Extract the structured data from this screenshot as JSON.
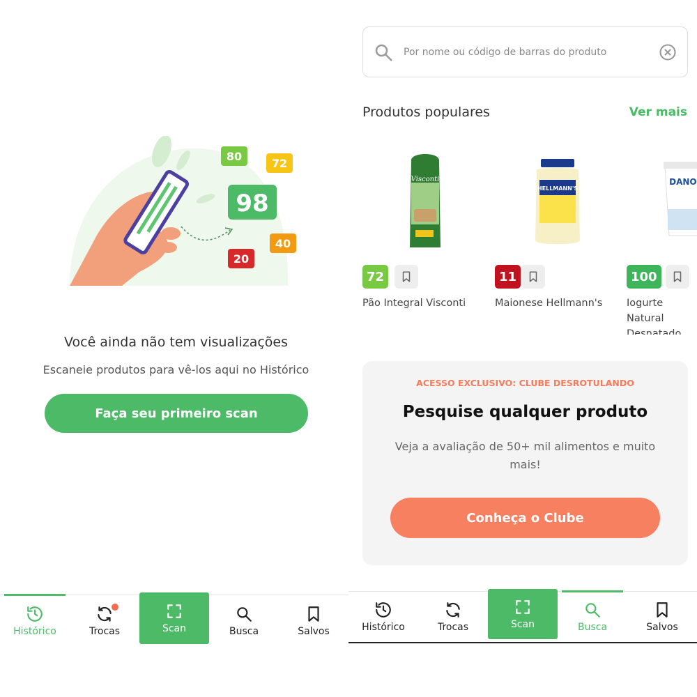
{
  "left_screen": {
    "illustration": {
      "scores": [
        "80",
        "72",
        "98",
        "40",
        "20"
      ]
    },
    "empty_title": "Você ainda não tem visualizações",
    "empty_subtitle": "Escaneie produtos para vê-los aqui no Histórico",
    "primary_button": "Faça seu primeiro scan",
    "tabs": [
      {
        "label": "Histórico",
        "icon": "history-icon",
        "active": true
      },
      {
        "label": "Trocas",
        "icon": "swap-icon",
        "notification": true
      },
      {
        "label": "Scan",
        "icon": "scan-icon"
      },
      {
        "label": "Busca",
        "icon": "search-icon"
      },
      {
        "label": "Salvos",
        "icon": "bookmark-icon"
      }
    ]
  },
  "right_screen": {
    "search": {
      "placeholder": "Por nome ou código de barras do produto"
    },
    "section_title": "Produtos populares",
    "see_more": "Ver mais",
    "products": [
      {
        "name": "Pão Integral Visconti",
        "score": "72",
        "score_color": "#7ac943",
        "brand_mark": "Visconti"
      },
      {
        "name": "Maionese Hellmann's",
        "score": "11",
        "score_color": "#c1121f",
        "brand_mark": "HELLMANN'S"
      },
      {
        "name": "Iogurte Natural Desnatado Danone",
        "score": "100",
        "score_color": "#3fb55b",
        "brand_mark": "DANONE"
      }
    ],
    "club": {
      "eyebrow": "ACESSO EXCLUSIVO: CLUBE DESROTULANDO",
      "title": "Pesquise qualquer produto",
      "description": "Veja a avaliação de 50+ mil alimentos e muito mais!",
      "button": "Conheça o Clube"
    },
    "tabs": [
      {
        "label": "Histórico",
        "icon": "history-icon"
      },
      {
        "label": "Trocas",
        "icon": "swap-icon"
      },
      {
        "label": "Scan",
        "icon": "scan-icon"
      },
      {
        "label": "Busca",
        "icon": "search-icon",
        "active": true
      },
      {
        "label": "Salvos",
        "icon": "bookmark-icon"
      }
    ]
  },
  "colors": {
    "brand_green": "#4cba67",
    "accent_orange": "#f6805f"
  }
}
